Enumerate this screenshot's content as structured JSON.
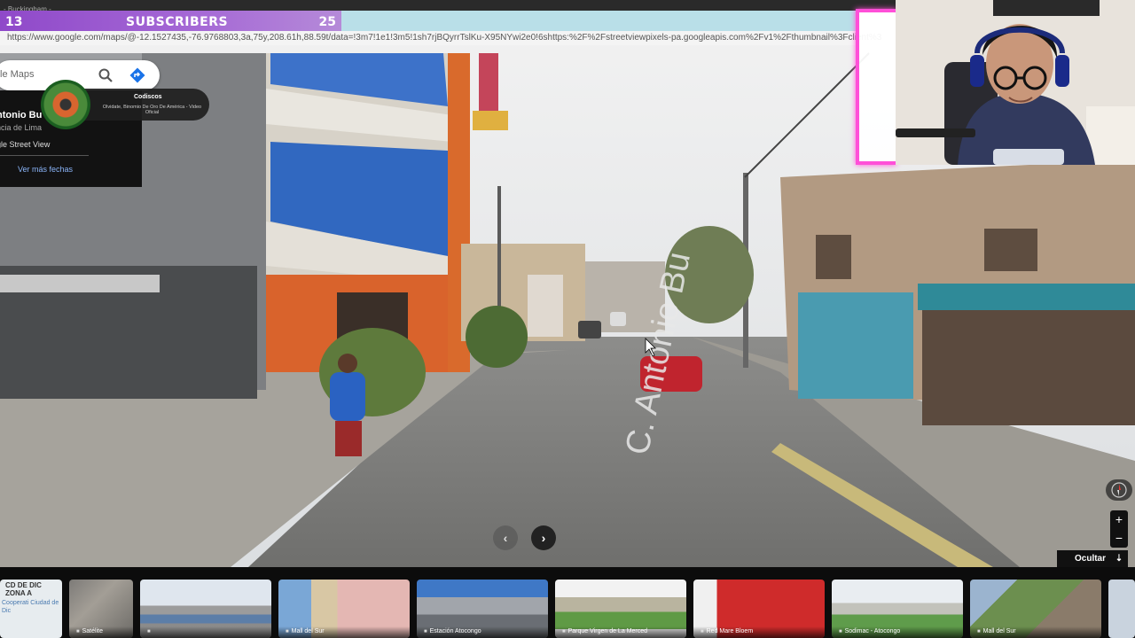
{
  "stream": {
    "subscribers_left": "13",
    "subscribers_title": "SUBSCRIBERS",
    "subscribers_right": "25",
    "top_strip_text": "- Buckingham - ..."
  },
  "browser": {
    "url": "https://www.google.com/maps/@-12.1527435,-76.9768803,3a,75y,208.61h,88.59t/data=!3m7!1e1!3m5!1sh7rjBQyrrTslKu-X95NYwi2e0!6shttps:%2F%2Fstreetviewpixels-pa.googleapis.com%2Fv1%2Fthumbnail%3Fclient%3"
  },
  "maps": {
    "search_placeholder": "le Maps",
    "place_name": "ntonio Bu",
    "province": "ncia de Lima",
    "source": "gle Street View",
    "more_dates": "Ver más fechas",
    "street_label": "C. Antonio Bu",
    "hide_label": "Ocultar",
    "zoom_in": "+",
    "zoom_out": "−"
  },
  "music": {
    "artist": "Codiscos",
    "song": "Olvidate, Binomio De Oro De América - Video Oficial"
  },
  "thumbnails": [
    {
      "title_top": "CD DE DIC ZONA A",
      "title_sub": "Cooperati Ciudad de Dic",
      "label": ""
    },
    {
      "label": "Satélite"
    },
    {
      "label": ""
    },
    {
      "label": "Mall del Sur"
    },
    {
      "label": "Estación Atocongo"
    },
    {
      "label": "Parque Virgen de La Merced"
    },
    {
      "label": "Red Mare Bloem"
    },
    {
      "label": "Sodimac - Atocongo"
    },
    {
      "label": "Mall del Sur"
    }
  ],
  "icons": {
    "search": "search-icon",
    "directions": "directions-icon",
    "chevron_left": "chevron-left-icon",
    "chevron_right": "chevron-right-icon",
    "compass": "compass-icon",
    "chevron_down": "chevron-down-icon"
  },
  "colors": {
    "subscriber_bar": "#9b59d0",
    "cam_border": "#ff4fd8",
    "maps_link": "#8ab4f8"
  }
}
